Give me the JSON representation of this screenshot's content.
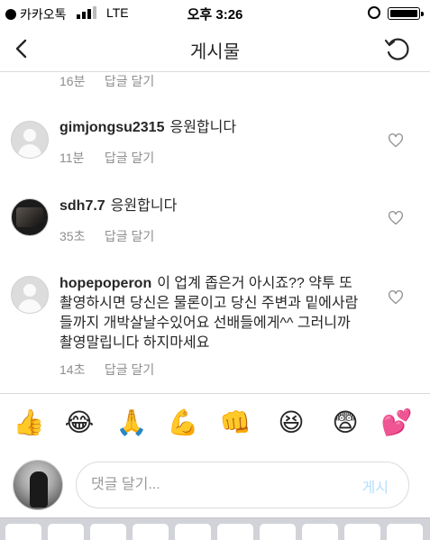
{
  "status_bar": {
    "carrier": "카카오톡",
    "network": "LTE",
    "time": "오후 3:26"
  },
  "header": {
    "title": "게시물"
  },
  "comments": [
    {
      "username": "",
      "text": "",
      "time": "16분",
      "reply_label": "답글 달기"
    },
    {
      "username": "gimjongsu2315",
      "text": "응원합니다",
      "time": "11분",
      "reply_label": "답글 달기"
    },
    {
      "username": "sdh7.7",
      "text": "응원합니다",
      "time": "35초",
      "reply_label": "답글 달기"
    },
    {
      "username": "hopepoperon",
      "text": "이 업계 좁은거 아시죠?? 약투 또 촬영하시면 당신은 물론이고 당신 주변과 밑에사람들까지 개박살날수있어요 선배들에게^^ 그러니까  촬영말립니다 하지마세요",
      "time": "14초",
      "reply_label": "답글 달기"
    }
  ],
  "emoji_bar": [
    {
      "glyph": "👍",
      "icon": "thumbs-up-icon"
    },
    {
      "glyph": "😂",
      "icon": "tears-of-joy-icon"
    },
    {
      "glyph": "🙏",
      "icon": "folded-hands-icon"
    },
    {
      "glyph": "💪",
      "icon": "flexed-biceps-icon"
    },
    {
      "glyph": "👊",
      "icon": "fist-bump-icon"
    },
    {
      "glyph": "😆",
      "icon": "laughing-icon"
    },
    {
      "glyph": "😨",
      "icon": "fearful-face-icon"
    },
    {
      "glyph": "💕",
      "icon": "two-hearts-icon"
    }
  ],
  "composer": {
    "placeholder": "댓글 달기...",
    "post_label": "게시"
  },
  "colors": {
    "text": "#262626",
    "meta": "#8e8e8e",
    "divider": "#dbdbdb",
    "post_button_disabled": "#b2dffc"
  }
}
